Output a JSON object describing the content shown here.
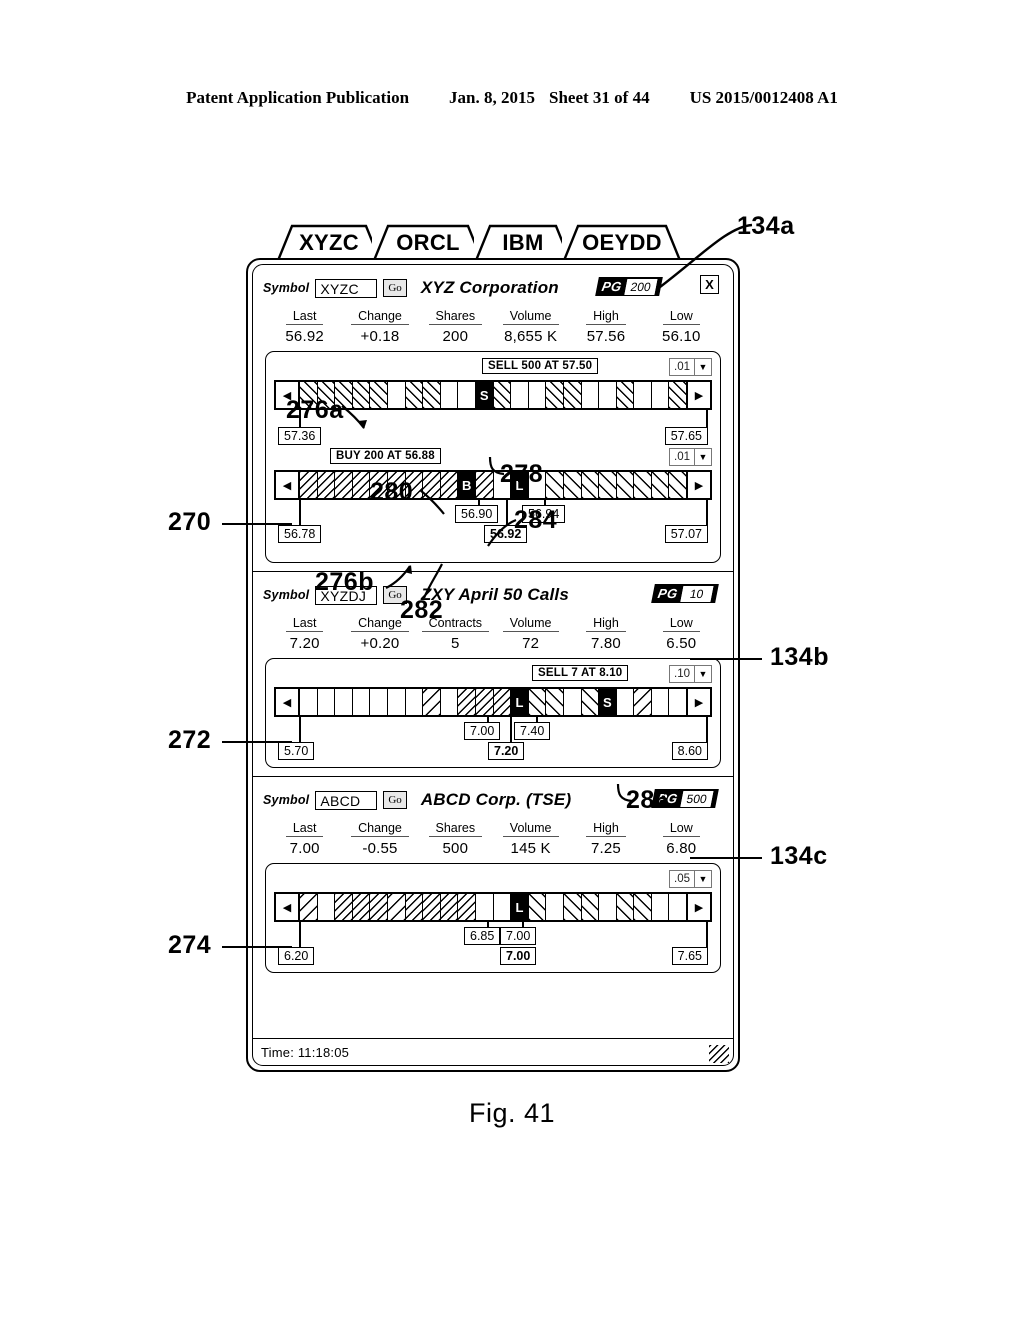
{
  "patent_header": {
    "title": "Patent Application Publication",
    "date": "Jan. 8, 2015",
    "sheet": "Sheet 31 of 44",
    "number": "US 2015/0012408 A1"
  },
  "figure_caption": "Fig. 41",
  "tabs": [
    {
      "label": "XYZC",
      "active": true
    },
    {
      "label": "ORCL",
      "active": false
    },
    {
      "label": "IBM",
      "active": false
    },
    {
      "label": "OEYDD",
      "active": false
    }
  ],
  "close_button": "X",
  "panels": [
    {
      "symbol_label": "Symbol",
      "symbol_value": "XYZC",
      "go_label": "Go",
      "company": "XYZ Corporation",
      "pg_label": "PG",
      "pg_value": "200",
      "stats": [
        {
          "header": "Last",
          "value": "56.92"
        },
        {
          "header": "Change",
          "value": "+0.18"
        },
        {
          "header": "Shares",
          "value": "200"
        },
        {
          "header": "Volume",
          "value": "8,655 K"
        },
        {
          "header": "High",
          "value": "57.56"
        },
        {
          "header": "Low",
          "value": "56.10"
        }
      ],
      "ladders": [
        {
          "order_tag": "SELL 500 AT 57.50",
          "tick_increment": ".01",
          "nav_left": "◀",
          "nav_right": "▶",
          "marker_labels": [
            "S"
          ],
          "low_price": "57.36",
          "high_price": "57.65",
          "mid_prices": []
        },
        {
          "order_tag": "BUY 200 AT 56.88",
          "tick_increment": ".01",
          "nav_left": "◀",
          "nav_right": "▶",
          "marker_labels": [
            "B",
            "L"
          ],
          "low_price": "56.78",
          "high_price": "57.07",
          "mid_prices": [
            "56.90",
            "56.92",
            "56.94"
          ]
        }
      ]
    },
    {
      "symbol_label": "Symbol",
      "symbol_value": "XYZDJ",
      "go_label": "Go",
      "company": "ZXY April 50 Calls",
      "pg_label": "PG",
      "pg_value": "10",
      "stats": [
        {
          "header": "Last",
          "value": "7.20"
        },
        {
          "header": "Change",
          "value": "+0.20"
        },
        {
          "header": "Contracts",
          "value": "5"
        },
        {
          "header": "Volume",
          "value": "72"
        },
        {
          "header": "High",
          "value": "7.80"
        },
        {
          "header": "Low",
          "value": "6.50"
        }
      ],
      "ladders": [
        {
          "order_tag": "SELL 7 AT 8.10",
          "tick_increment": ".10",
          "nav_left": "◀",
          "nav_right": "▶",
          "marker_labels": [
            "L",
            "S"
          ],
          "low_price": "5.70",
          "high_price": "8.60",
          "mid_prices": [
            "7.00",
            "7.20",
            "7.40"
          ]
        }
      ]
    },
    {
      "symbol_label": "Symbol",
      "symbol_value": "ABCD",
      "go_label": "Go",
      "company": "ABCD Corp. (TSE)",
      "pg_label": "PG",
      "pg_value": "500",
      "stats": [
        {
          "header": "Last",
          "value": "7.00"
        },
        {
          "header": "Change",
          "value": "-0.55"
        },
        {
          "header": "Shares",
          "value": "500"
        },
        {
          "header": "Volume",
          "value": "145 K"
        },
        {
          "header": "High",
          "value": "7.25"
        },
        {
          "header": "Low",
          "value": "6.80"
        }
      ],
      "ladders": [
        {
          "order_tag": "",
          "tick_increment": ".05",
          "nav_left": "◀",
          "nav_right": "▶",
          "marker_labels": [
            "L"
          ],
          "low_price": "6.20",
          "high_price": "7.65",
          "mid_prices": [
            "6.85",
            "7.00",
            "7.00"
          ]
        }
      ]
    }
  ],
  "status_bar": {
    "time_text": "Time: 11:18:05"
  },
  "reference_numerals": {
    "r134a": "134a",
    "r134b": "134b",
    "r134c": "134c",
    "r270": "270",
    "r272": "272",
    "r274": "274",
    "r276a": "276a",
    "r276b": "276b",
    "r278": "278",
    "r280": "280",
    "r282": "282",
    "r284": "284",
    "r286": "286"
  }
}
